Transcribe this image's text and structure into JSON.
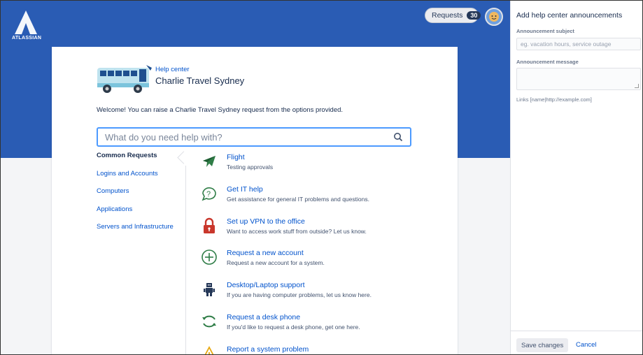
{
  "header": {
    "logo_text": "ATLASSIAN",
    "requests_label": "Requests",
    "requests_count": "30"
  },
  "help_center": {
    "label": "Help center",
    "title": "Charlie Travel Sydney",
    "welcome": "Welcome! You can raise a Charlie Travel Sydney request from the options provided.",
    "search_placeholder": "What do you need help with?"
  },
  "categories": [
    {
      "label": "Common Requests",
      "active": true
    },
    {
      "label": "Logins and Accounts"
    },
    {
      "label": "Computers"
    },
    {
      "label": "Applications"
    },
    {
      "label": "Servers and Infrastructure"
    }
  ],
  "request_types": [
    {
      "title": "Flight",
      "description": "Testing approvals",
      "icon": "airplane-icon"
    },
    {
      "title": "Get IT help",
      "description": "Get assistance for general IT problems and questions.",
      "icon": "question-bubble-icon"
    },
    {
      "title": "Set up VPN to the office",
      "description": "Want to access work stuff from outside? Let us know.",
      "icon": "padlock-icon"
    },
    {
      "title": "Request a new account",
      "description": "Request a new account for a system.",
      "icon": "add-circle-icon"
    },
    {
      "title": "Desktop/Laptop support",
      "description": "If you are having computer problems, let us know here.",
      "icon": "robot-icon"
    },
    {
      "title": "Request a desk phone",
      "description": "If you'd like to request a desk phone, get one here.",
      "icon": "refresh-arrows-icon"
    },
    {
      "title": "Report a system problem",
      "description": "",
      "icon": "warning-icon"
    }
  ],
  "panel": {
    "title": "Add help center announcements",
    "subject_label": "Announcement subject",
    "subject_placeholder": "eg. vacation hours, service outage",
    "message_label": "Announcement message",
    "hint": "Links [name|http://example.com]",
    "save_label": "Save changes",
    "cancel_label": "Cancel"
  },
  "colors": {
    "header_blue": "#2a5cb4",
    "link_blue": "#0052cc",
    "icon_green": "#2f7d47",
    "lock_red": "#c9372c",
    "warning_yellow": "#e8a80f"
  }
}
